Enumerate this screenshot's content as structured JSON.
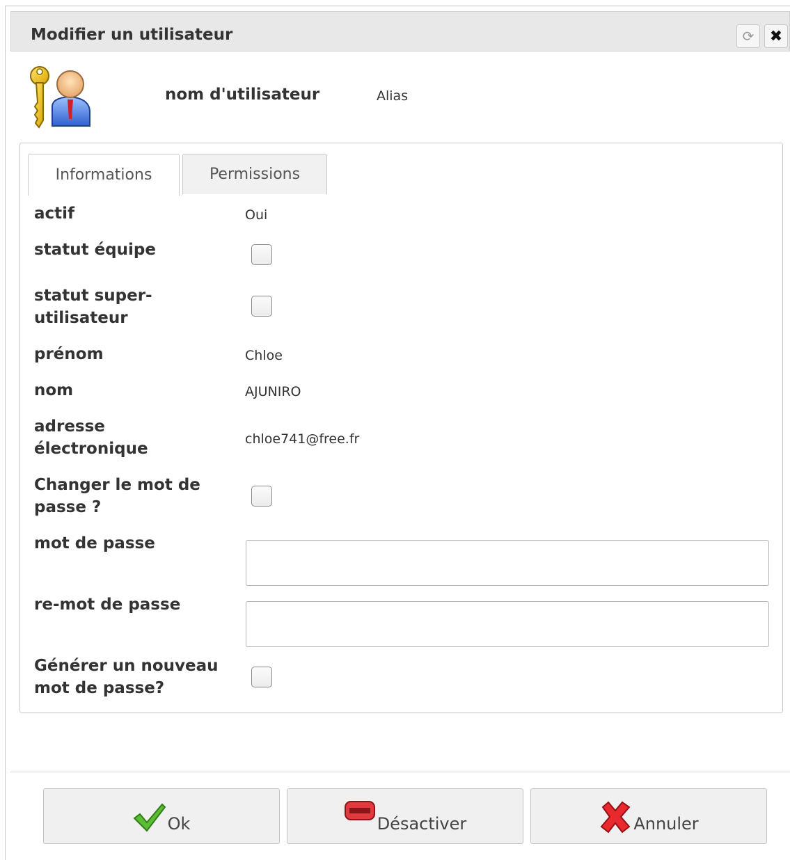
{
  "dialog": {
    "title": "Modifier un utilisateur",
    "refresh_icon": "refresh-icon",
    "close_icon": "close-icon"
  },
  "header": {
    "icon": "user-key-icon",
    "username_label": "nom d'utilisateur",
    "alias": "Alias"
  },
  "tabs": [
    {
      "label": "Informations",
      "active": true
    },
    {
      "label": "Permissions",
      "active": false
    }
  ],
  "fields": {
    "actif": {
      "label": "actif",
      "value": "Oui"
    },
    "statut_equipe": {
      "label": "statut équipe",
      "checked": false
    },
    "statut_super": {
      "label": "statut super-utilisateur",
      "checked": false
    },
    "prenom": {
      "label": "prénom",
      "value": "Chloe"
    },
    "nom": {
      "label": "nom",
      "value": "AJUNIRO"
    },
    "email": {
      "label": "adresse électronique",
      "value": "chloe741@free.fr"
    },
    "changer_mdp": {
      "label": "Changer le mot de passe ?",
      "checked": false
    },
    "mot_de_passe": {
      "label": "mot de passe",
      "value": ""
    },
    "re_mot_de_passe": {
      "label": "re-mot de passe",
      "value": ""
    },
    "generer": {
      "label": "Générer un nouveau mot de passe?",
      "checked": false
    }
  },
  "buttons": {
    "ok": {
      "label": "Ok",
      "icon": "checkmark-icon",
      "color": "#4caf2c"
    },
    "deactivate": {
      "label": "Désactiver",
      "icon": "minus-icon",
      "color": "#d8232a"
    },
    "cancel": {
      "label": "Annuler",
      "icon": "red-x-icon",
      "color": "#e0262b"
    }
  }
}
